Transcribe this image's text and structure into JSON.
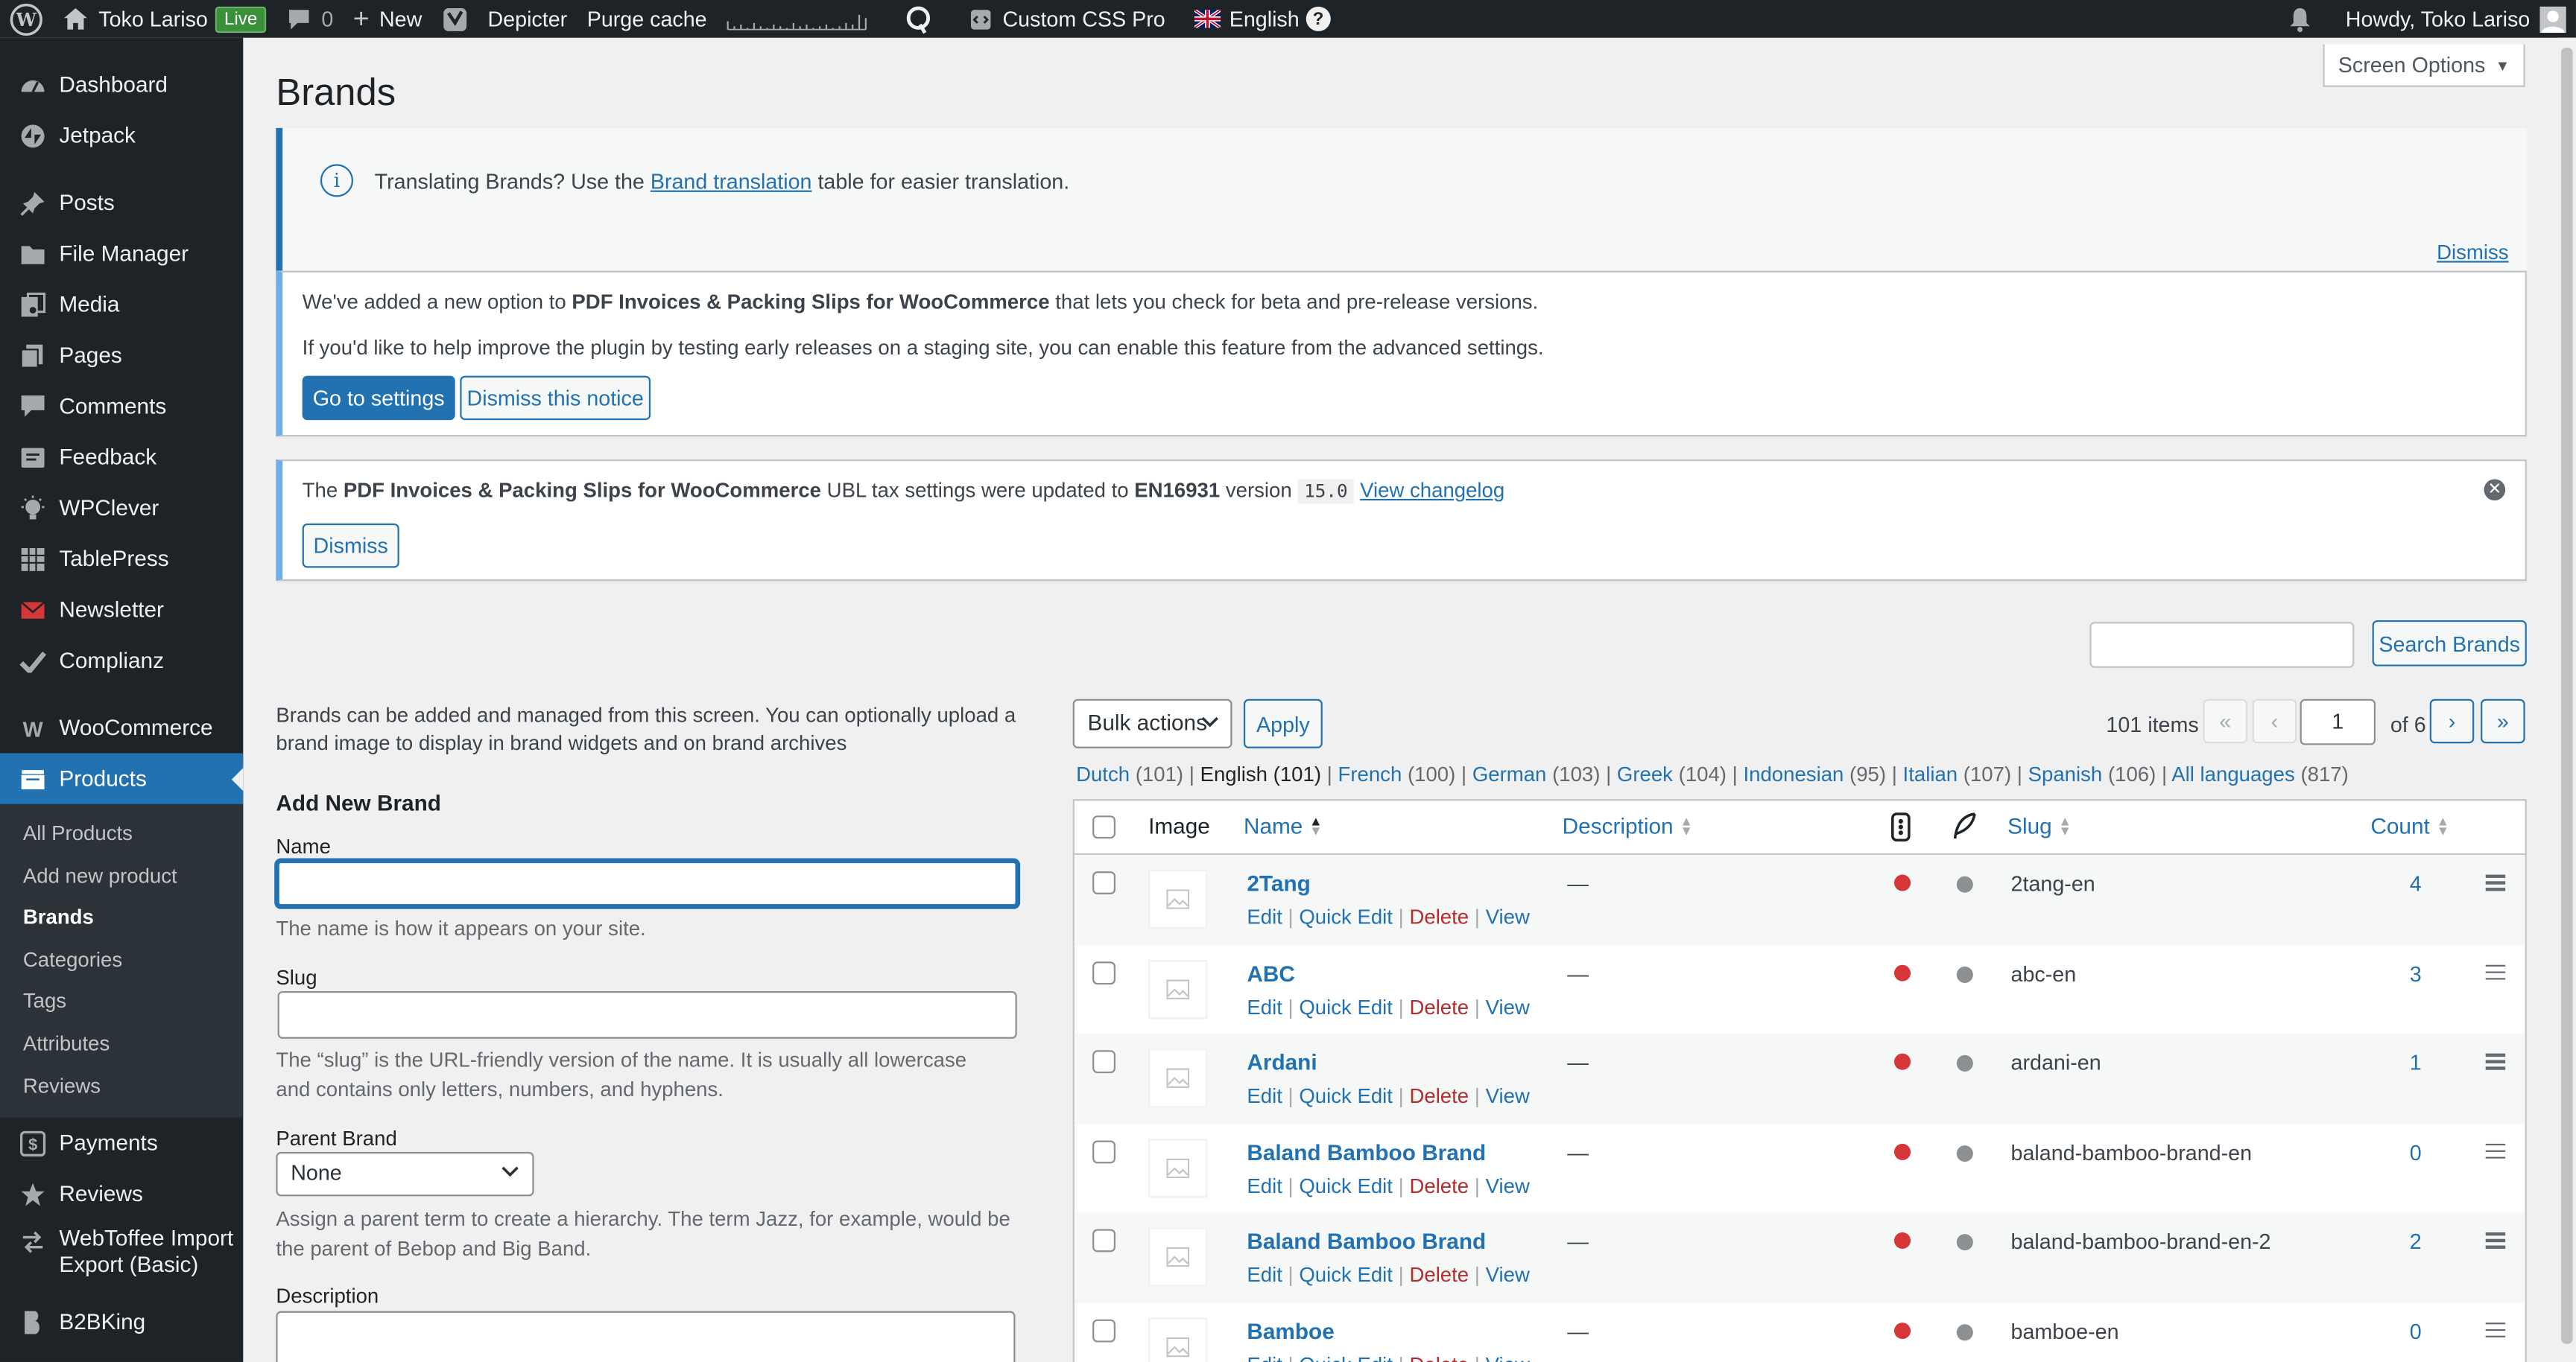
{
  "adminbar": {
    "site_name": "Toko Lariso",
    "live_badge": "Live",
    "comments_count": "0",
    "new_label": "New",
    "depicter": "Depicter",
    "purge_cache": "Purge cache",
    "custom_css": "Custom CSS Pro",
    "language": "English",
    "howdy": "Howdy, Toko Lariso"
  },
  "sidebar": {
    "items": [
      {
        "label": "Dashboard",
        "icon": "dashboard-icon"
      },
      {
        "label": "Jetpack",
        "icon": "jetpack-icon"
      },
      {
        "label": "Posts",
        "icon": "pin-icon"
      },
      {
        "label": "File Manager",
        "icon": "folder-icon"
      },
      {
        "label": "Media",
        "icon": "media-icon"
      },
      {
        "label": "Pages",
        "icon": "pages-icon"
      },
      {
        "label": "Comments",
        "icon": "comment-icon"
      },
      {
        "label": "Feedback",
        "icon": "feedback-icon"
      },
      {
        "label": "WPClever",
        "icon": "wpclever-icon"
      },
      {
        "label": "TablePress",
        "icon": "table-icon"
      },
      {
        "label": "Newsletter",
        "icon": "newsletter-icon"
      },
      {
        "label": "Complianz",
        "icon": "check-icon"
      },
      {
        "label": "WooCommerce",
        "icon": "woocommerce-icon"
      },
      {
        "label": "Products",
        "icon": "products-icon"
      }
    ],
    "submenu": [
      "All Products",
      "Add new product",
      "Brands",
      "Categories",
      "Tags",
      "Attributes",
      "Reviews"
    ],
    "after": [
      {
        "label": "Payments",
        "icon": "payments-icon"
      },
      {
        "label": "Reviews",
        "icon": "star-icon"
      },
      {
        "label": "WebToffee Import Export (Basic)",
        "icon": "import-export-icon"
      },
      {
        "label": "B2BKing",
        "icon": "b2bking-icon"
      }
    ]
  },
  "page": {
    "title": "Brands",
    "screen_options": "Screen Options"
  },
  "notice1": {
    "text_before": "Translating Brands? Use the ",
    "link": "Brand translation",
    "text_after": " table for easier translation.",
    "dismiss": "Dismiss"
  },
  "notice2": {
    "line1_before": "We've added a new option to ",
    "line1_bold": "PDF Invoices & Packing Slips for WooCommerce",
    "line1_after": " that lets you check for beta and pre-release versions.",
    "line2": "If you'd like to help improve the plugin by testing early releases on a staging site, you can enable this feature from the advanced settings.",
    "btn_settings": "Go to settings",
    "btn_dismiss": "Dismiss this notice"
  },
  "notice3": {
    "the": "The ",
    "bold1": "PDF Invoices & Packing Slips for WooCommerce",
    "middle": " UBL tax settings were updated to ",
    "bold2": "EN16931",
    "version_label": " version ",
    "version": "15.0",
    "link": "View changelog",
    "dismiss": "Dismiss"
  },
  "search": {
    "button": "Search Brands",
    "value": ""
  },
  "form": {
    "intro": "Brands can be added and managed from this screen. You can optionally upload a brand image to display in brand widgets and on brand archives",
    "heading": "Add New Brand",
    "name_label": "Name",
    "name_help": "The name is how it appears on your site.",
    "slug_label": "Slug",
    "slug_help": "The “slug” is the URL-friendly version of the name. It is usually all lowercase and contains only letters, numbers, and hyphens.",
    "parent_label": "Parent Brand",
    "parent_value": "None",
    "parent_help": "Assign a parent term to create a hierarchy. The term Jazz, for example, would be the parent of Bebop and Big Band.",
    "desc_label": "Description"
  },
  "tablenav": {
    "bulk": "Bulk actions",
    "apply": "Apply",
    "items": "101 items",
    "first": "«",
    "prev": "‹",
    "page": "1",
    "of": "of 6",
    "next": "›",
    "last": "»"
  },
  "languages": [
    {
      "name": "Dutch",
      "count": "(101)"
    },
    {
      "name": "English",
      "count": "(101)"
    },
    {
      "name": "French",
      "count": "(100)"
    },
    {
      "name": "German",
      "count": "(103)"
    },
    {
      "name": "Greek",
      "count": "(104)"
    },
    {
      "name": "Indonesian",
      "count": "(95)"
    },
    {
      "name": "Italian",
      "count": "(107)"
    },
    {
      "name": "Spanish",
      "count": "(106)"
    },
    {
      "name": "All languages",
      "count": "(817)"
    }
  ],
  "table": {
    "headers": {
      "image": "Image",
      "name": "Name",
      "description": "Description",
      "slug": "Slug",
      "count": "Count"
    },
    "row_actions": {
      "edit": "Edit",
      "quick_edit": "Quick Edit",
      "delete": "Delete",
      "view": "View"
    },
    "rows": [
      {
        "name": "2Tang",
        "desc": "—",
        "slug": "2tang-en",
        "count": "4"
      },
      {
        "name": "ABC",
        "desc": "—",
        "slug": "abc-en",
        "count": "3"
      },
      {
        "name": "Ardani",
        "desc": "—",
        "slug": "ardani-en",
        "count": "1"
      },
      {
        "name": "Baland Bamboo Brand",
        "desc": "—",
        "slug": "baland-bamboo-brand-en",
        "count": "0"
      },
      {
        "name": "Baland Bamboo Brand",
        "desc": "—",
        "slug": "baland-bamboo-brand-en-2",
        "count": "2"
      },
      {
        "name": "Bamboe",
        "desc": "—",
        "slug": "bamboe-en",
        "count": "0"
      }
    ]
  },
  "colors": {
    "admin_dark": "#1d2327",
    "accent": "#2271b1",
    "delete": "#b32d2e",
    "status_red": "#d63638"
  }
}
